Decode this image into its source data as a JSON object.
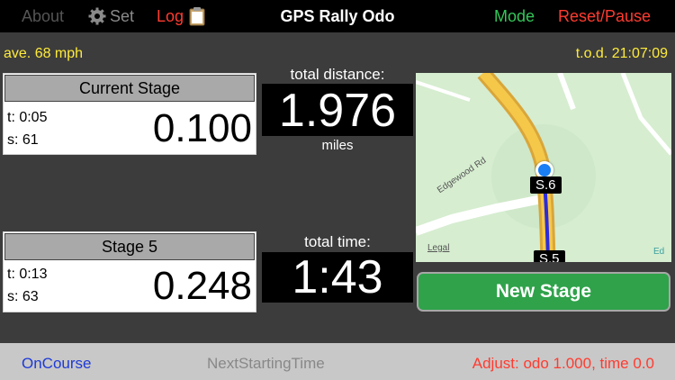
{
  "topbar": {
    "about": "About",
    "set": "Set",
    "log": "Log",
    "title": "GPS Rally Odo",
    "mode": "Mode",
    "reset_pause": "Reset/Pause"
  },
  "status": {
    "average": "ave. 68 mph",
    "time_of_day": "t.o.d. 21:07:09"
  },
  "current_stage": {
    "title": "Current Stage",
    "time": "t: 0:05",
    "speed": "s: 61",
    "distance": "0.100"
  },
  "previous_stage": {
    "title": "Stage 5",
    "time": "t: 0:13",
    "speed": "s: 63",
    "distance": "0.248"
  },
  "totals": {
    "distance_label": "total distance:",
    "distance_value": "1.976",
    "distance_unit": "miles",
    "time_label": "total time:",
    "time_value": "1:43"
  },
  "map": {
    "road_label": "Edgewood Rd",
    "legal": "Legal",
    "edge_text": "Ed",
    "marker_current": "S.6",
    "marker_previous": "S.5"
  },
  "new_stage_button": "New Stage",
  "bottombar": {
    "oncourse": "OnCourse",
    "next_starting_time": "NextStartingTime",
    "adjust": "Adjust: odo 1.000, time 0.0"
  },
  "colors": {
    "accent_green": "#2fa24a",
    "danger_red": "#ff3b30",
    "highlight_yellow": "#ffeb3b",
    "link_blue": "#1e3ad6"
  }
}
